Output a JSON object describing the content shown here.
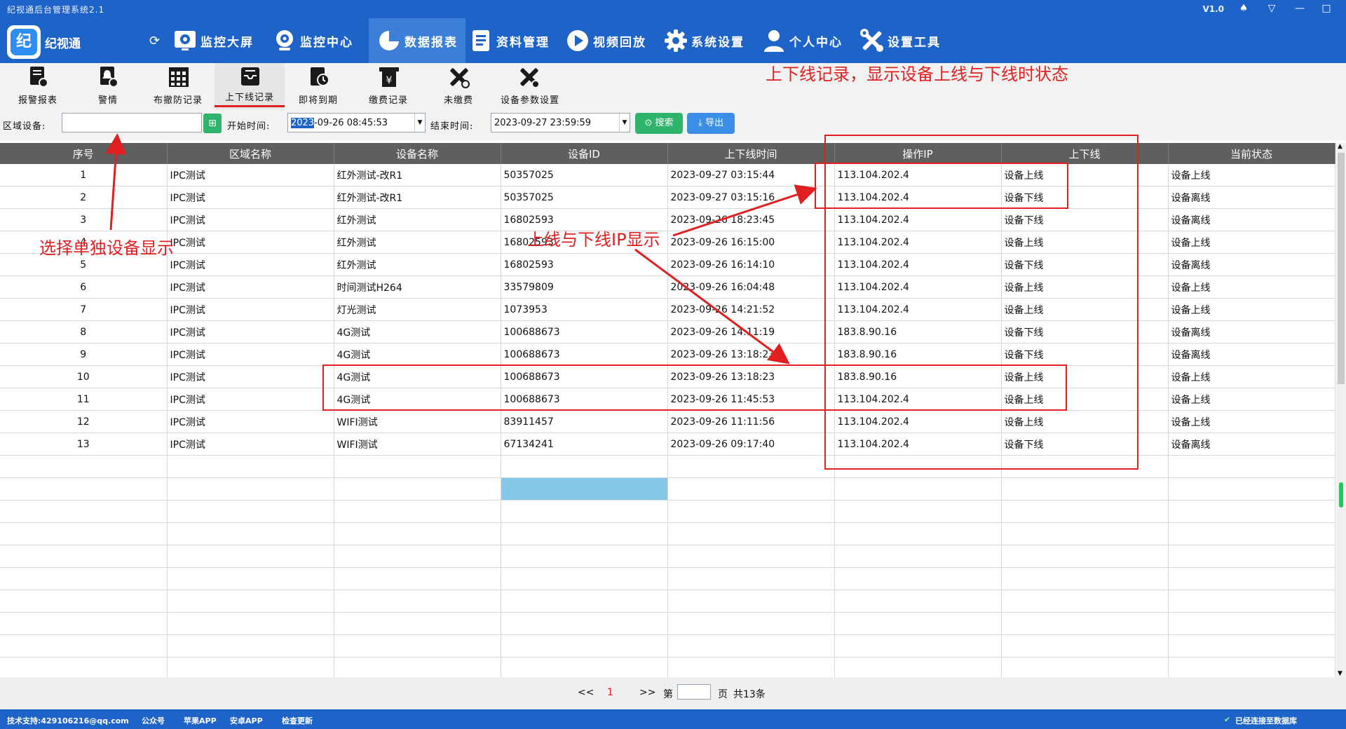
{
  "window": {
    "title": "纪视通后台管理系统2.1",
    "version": "V1.0",
    "controls": [
      "♠",
      "▽",
      "—",
      "□",
      "✕"
    ]
  },
  "app": {
    "brand": "纪视通",
    "logo_text": "纪"
  },
  "nav": {
    "items": [
      {
        "label": "监控大屏"
      },
      {
        "label": "监控中心"
      },
      {
        "label": "数据报表"
      },
      {
        "label": "资料管理"
      },
      {
        "label": "视频回放"
      },
      {
        "label": "系统设置"
      },
      {
        "label": "个人中心"
      },
      {
        "label": "设置工具"
      }
    ]
  },
  "subtabs": [
    {
      "label": "报警报表"
    },
    {
      "label": "警情"
    },
    {
      "label": "布撤防记录"
    },
    {
      "label": "上下线记录"
    },
    {
      "label": "即将到期"
    },
    {
      "label": "缴费记录"
    },
    {
      "label": "未缴费"
    },
    {
      "label": "设备参数设置"
    }
  ],
  "filter": {
    "area_label": "区域设备:",
    "area_value": "",
    "start_label": "开始时间:",
    "start_year": "2023",
    "start_rest": "-09-26 08:45:53",
    "end_label": "结束时间:",
    "end_value": "2023-09-27 23:59:59",
    "search_label": "搜索",
    "export_label": "导出"
  },
  "table": {
    "headers": [
      "序号",
      "区域名称",
      "设备名称",
      "设备ID",
      "上下线时间",
      "操作IP",
      "上下线",
      "当前状态"
    ],
    "rows": [
      [
        "1",
        "IPC测试",
        "红外测试-改R1",
        "50357025",
        "2023-09-27 03:15:44",
        "113.104.202.4",
        "设备上线",
        "设备上线"
      ],
      [
        "2",
        "IPC测试",
        "红外测试-改R1",
        "50357025",
        "2023-09-27 03:15:16",
        "113.104.202.4",
        "设备下线",
        "设备离线"
      ],
      [
        "3",
        "IPC测试",
        "红外测试",
        "16802593",
        "2023-09-26 18:23:45",
        "113.104.202.4",
        "设备下线",
        "设备离线"
      ],
      [
        "4",
        "IPC测试",
        "红外测试",
        "16802593",
        "2023-09-26 16:15:00",
        "113.104.202.4",
        "设备上线",
        "设备上线"
      ],
      [
        "5",
        "IPC测试",
        "红外测试",
        "16802593",
        "2023-09-26 16:14:10",
        "113.104.202.4",
        "设备下线",
        "设备离线"
      ],
      [
        "6",
        "IPC测试",
        "时间测试H264",
        "33579809",
        "2023-09-26 16:04:48",
        "113.104.202.4",
        "设备上线",
        "设备上线"
      ],
      [
        "7",
        "IPC测试",
        "灯光测试",
        "1073953",
        "2023-09-26 14:21:52",
        "113.104.202.4",
        "设备上线",
        "设备上线"
      ],
      [
        "8",
        "IPC测试",
        "4G测试",
        "100688673",
        "2023-09-26 14:11:19",
        "183.8.90.16",
        "设备下线",
        "设备离线"
      ],
      [
        "9",
        "IPC测试",
        "4G测试",
        "100688673",
        "2023-09-26 13:18:23",
        "183.8.90.16",
        "设备下线",
        "设备离线"
      ],
      [
        "10",
        "IPC测试",
        "4G测试",
        "100688673",
        "2023-09-26 13:18:23",
        "183.8.90.16",
        "设备上线",
        "设备上线"
      ],
      [
        "11",
        "IPC测试",
        "4G测试",
        "100688673",
        "2023-09-26 11:45:53",
        "113.104.202.4",
        "设备上线",
        "设备上线"
      ],
      [
        "12",
        "IPC测试",
        "WIFI测试",
        "83911457",
        "2023-09-26 11:11:56",
        "113.104.202.4",
        "设备上线",
        "设备上线"
      ],
      [
        "13",
        "IPC测试",
        "WIFI测试",
        "67134241",
        "2023-09-26 09:17:40",
        "113.104.202.4",
        "设备下线",
        "设备离线"
      ]
    ]
  },
  "pager": {
    "prev": "<<",
    "current": "1",
    "next": ">>",
    "goto_prefix": "第",
    "goto_value": "",
    "goto_suffix": "页",
    "total": "共13条"
  },
  "statusbar": {
    "support": "技术支持:429106216@qq.com",
    "links": [
      "公众号",
      "苹果APP",
      "安卓APP",
      "检查更新"
    ],
    "connection": "已经连接至数据库"
  },
  "annotations": {
    "title": "上下线记录，显示设备上线与下线时状态",
    "select_device": "选择单独设备显示",
    "ip_display": "上线与下线IP显示"
  },
  "colors": {
    "brand_blue": "#1e63c8",
    "header_gray": "#5f5f5f",
    "annotation_red": "#e02020",
    "search_green": "#2fb56b",
    "export_blue": "#3a8ee6",
    "selected_cell": "#87c8ea"
  }
}
